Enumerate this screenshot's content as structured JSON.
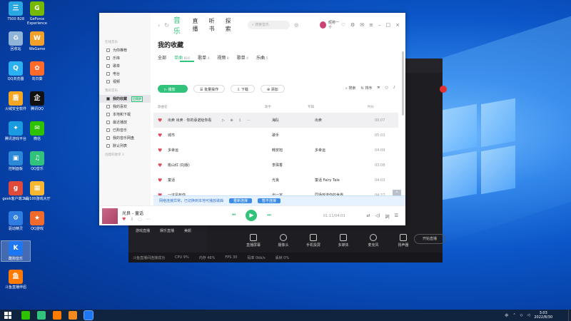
{
  "desktop": {
    "icons": [
      {
        "label": "7500 B28",
        "color": "#2aa7e0",
        "glyph": "三"
      },
      {
        "label": "GeForce Experience",
        "color": "#76b900",
        "glyph": "G"
      },
      {
        "label": "回收站",
        "color": "#8fb4d8",
        "glyph": "♻"
      },
      {
        "label": "WeGame",
        "color": "#f1a02a",
        "glyph": "W"
      },
      {
        "label": "QQ浏览器",
        "color": "#2bb0f2",
        "glyph": "Q"
      },
      {
        "label": "向日葵",
        "color": "#ff6a2b",
        "glyph": "✿"
      },
      {
        "label": "火绒安全软件",
        "color": "#f5a623",
        "glyph": "盾"
      },
      {
        "label": "腾讯QQ",
        "color": "#111111",
        "glyph": "企"
      },
      {
        "label": "腾讯游戏平台",
        "color": "#1b9bdf",
        "glyph": "✦"
      },
      {
        "label": "微信",
        "color": "#2dc100",
        "glyph": "✉"
      },
      {
        "label": "控制面板",
        "color": "#2d88d8",
        "glyph": "▣"
      },
      {
        "label": "QQ音乐",
        "color": "#31c27c",
        "glyph": "♫"
      },
      {
        "label": "geek客户端工具",
        "color": "#e04a3a",
        "glyph": "g"
      },
      {
        "label": "my100游戏大厅",
        "color": "#f7b731",
        "glyph": "▦"
      },
      {
        "label": "驱动精灵",
        "color": "#2f7de1",
        "glyph": "⚙"
      },
      {
        "label": "QQ游戏",
        "color": "#f06b2b",
        "glyph": "★"
      },
      {
        "label": "酷狗音乐",
        "color": "#1d77f2",
        "glyph": "K"
      },
      {
        "label": "斗鱼直播伴侣",
        "color": "#ff7a00",
        "glyph": "鱼"
      }
    ]
  },
  "music_app": {
    "nav": {
      "tabs": [
        "音乐",
        "直播",
        "听书",
        "探索"
      ],
      "search_placeholder": "搜索音乐",
      "username": "昵称一个"
    },
    "sidebar": {
      "section_online": "在线音乐",
      "online_items": [
        "为你推荐",
        "乐库",
        "歌单",
        "电台",
        "视频"
      ],
      "section_mine": "我的音乐",
      "mine_items": [
        "我的收藏",
        "我的喜欢",
        "本地和下载",
        "最近播放",
        "已购音乐",
        "我的音乐网盘",
        "默认列表"
      ],
      "active_badge": "已同步",
      "section_created": "创建的歌单 3"
    },
    "page_title": "我的收藏",
    "subtabs": [
      {
        "label": "全部",
        "count": ""
      },
      {
        "label": "单曲",
        "count": "816"
      },
      {
        "label": "歌单",
        "count": "4"
      },
      {
        "label": "视频",
        "count": "8"
      },
      {
        "label": "歌单",
        "count": "4"
      },
      {
        "label": "乐曲",
        "count": "5"
      }
    ],
    "actions": {
      "play": "播放",
      "batch": "批量操作",
      "download": "下载",
      "add": "添加"
    },
    "right_tools": [
      "搜索",
      "排序"
    ],
    "columns": {
      "title": "歌曲名",
      "artist": "歌手",
      "album": "专辑",
      "duration": "时长"
    },
    "songs": [
      {
        "title": "出卖 出卖",
        "extra": "你的承诺给你看",
        "artist": "海队",
        "album": "出卖",
        "duration": "00:07"
      },
      {
        "title": "城市",
        "extra": "",
        "artist": "歌手",
        "album": "",
        "duration": "05:03"
      },
      {
        "title": "多幸运",
        "extra": "",
        "artist": "韩安旭",
        "album": "多幸运",
        "duration": "04:09"
      },
      {
        "title": "桃山红 (DJ版)",
        "extra": "",
        "artist": "李珠香",
        "album": "",
        "duration": "03:08"
      },
      {
        "title": "童话",
        "extra": "",
        "artist": "光良",
        "album": "童话 Fairy Tale",
        "duration": "04:03"
      },
      {
        "title": "一这是有你",
        "extra": "",
        "artist": "出一定",
        "album": "同场放送你的世界",
        "duration": "04:27"
      }
    ],
    "notice": {
      "text": "网络连接异常，已切换到本地可播放歌曲",
      "btn1": "重新连接",
      "btn2": "暂不连接"
    },
    "player": {
      "now_playing": "光良 - 童话",
      "time": "01:11/04:03"
    }
  },
  "live_app": {
    "tools": [
      "直播屏幕",
      "摄像头",
      "手机投屏",
      "多媒体",
      "麦克风",
      "扬声器"
    ],
    "left_items": [
      "游戏直播",
      "娱乐直播",
      "美颜"
    ],
    "start_label": "开始直播",
    "status": "斗鱼直播间连接成功",
    "bottom_stats": [
      "CPU 9%",
      "内存 46%",
      "FPS 30",
      "码率 0kb/s",
      "丢帧 0%"
    ]
  },
  "taskbar": {
    "time": "3:03",
    "date": "2022/8/30",
    "lang": "中"
  }
}
